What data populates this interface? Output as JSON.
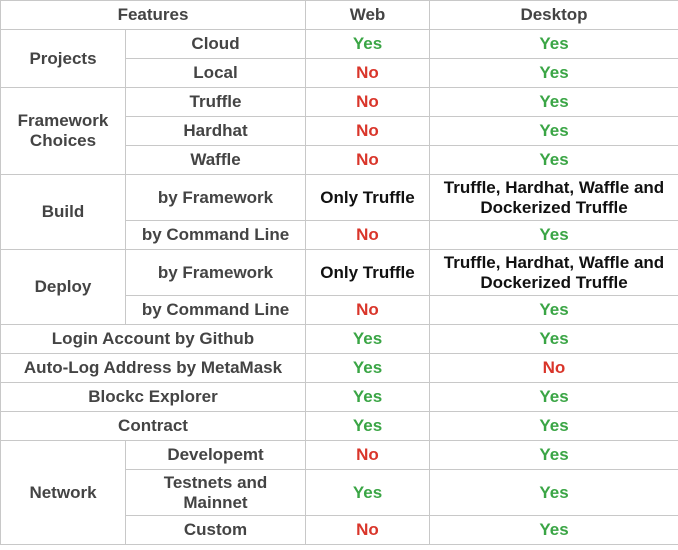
{
  "header": {
    "features": "Features",
    "web": "Web",
    "desktop": "Desktop"
  },
  "groups": {
    "projects": "Projects",
    "framework_choices": "Framework Choices",
    "build": "Build",
    "deploy": "Deploy",
    "network": "Network"
  },
  "rows": [
    {
      "feature": "Cloud",
      "web": "Yes",
      "desktop": "Yes"
    },
    {
      "feature": "Local",
      "web": "No",
      "desktop": "Yes"
    },
    {
      "feature": "Truffle",
      "web": "No",
      "desktop": "Yes"
    },
    {
      "feature": "Hardhat",
      "web": "No",
      "desktop": "Yes"
    },
    {
      "feature": "Waffle",
      "web": "No",
      "desktop": "Yes"
    },
    {
      "feature": "by Framework",
      "web": "Only Truffle",
      "desktop": "Truffle, Hardhat, Waffle and Dockerized Truffle"
    },
    {
      "feature": "by Command Line",
      "web": "No",
      "desktop": "Yes"
    },
    {
      "feature": "by Framework",
      "web": "Only Truffle",
      "desktop": "Truffle, Hardhat, Waffle and Dockerized Truffle"
    },
    {
      "feature": "by Command Line",
      "web": "No",
      "desktop": "Yes"
    },
    {
      "feature": "Login Account by Github",
      "web": "Yes",
      "desktop": "Yes"
    },
    {
      "feature": "Auto-Log Address by MetaMask",
      "web": "Yes",
      "desktop": "No"
    },
    {
      "feature": "Blockc Explorer",
      "web": "Yes",
      "desktop": "Yes"
    },
    {
      "feature": "Contract",
      "web": "Yes",
      "desktop": "Yes"
    },
    {
      "feature": "Developemt",
      "web": "No",
      "desktop": "Yes"
    },
    {
      "feature": "Testnets and Mainnet",
      "web": "Yes",
      "desktop": "Yes"
    },
    {
      "feature": "Custom",
      "web": "No",
      "desktop": "Yes"
    }
  ],
  "colors": {
    "yes": "#3aa545",
    "no": "#d9352a",
    "border": "#c8c8c8",
    "text": "#444444"
  }
}
